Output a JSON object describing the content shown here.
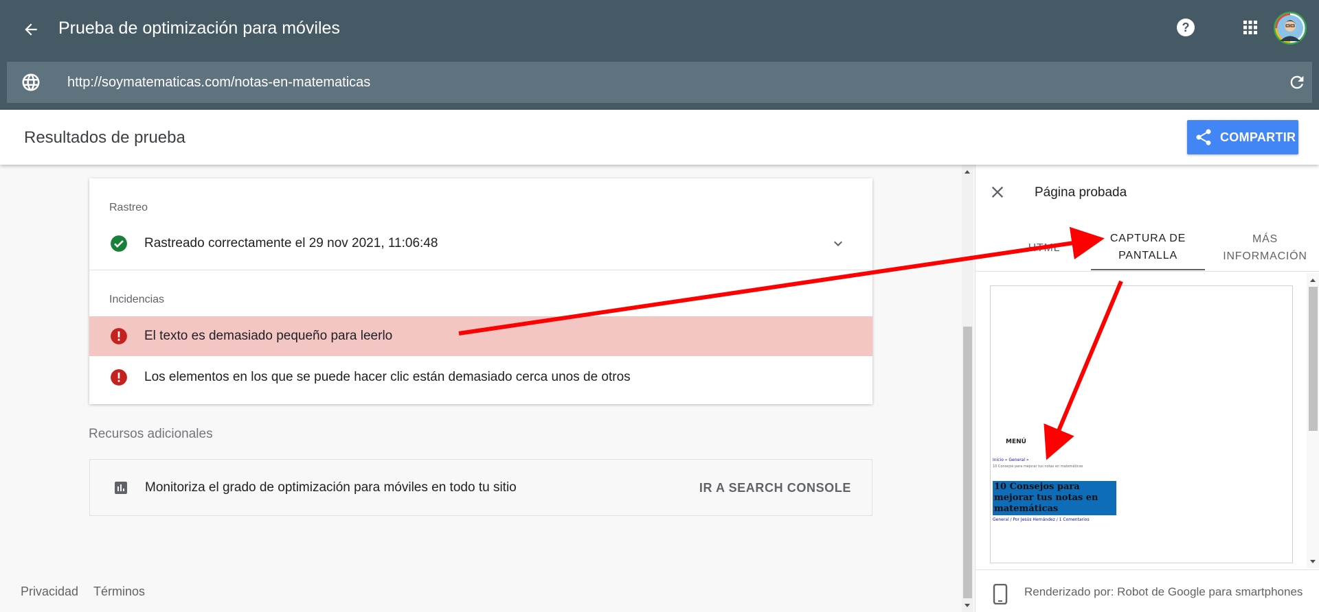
{
  "header": {
    "title": "Prueba de optimización para móviles",
    "url": "http://soymatematicas.com/notas-en-matematicas"
  },
  "results": {
    "title": "Resultados de prueba",
    "share_label": "COMPARTIR"
  },
  "crawl": {
    "section_label": "Rastreo",
    "status_text": "Rastreado correctamente el 29 nov 2021, 11:06:48"
  },
  "issues": {
    "section_label": "Incidencias",
    "items": [
      "El texto es demasiado pequeño para leerlo",
      "Los elementos en los que se puede hacer clic están demasiado cerca unos de otros"
    ]
  },
  "resources": {
    "label": "Recursos adicionales",
    "text": "Monitoriza el grado de optimización para móviles en todo tu sitio",
    "link": "IR A SEARCH CONSOLE"
  },
  "footer": {
    "privacy": "Privacidad",
    "terms": "Términos"
  },
  "panel": {
    "title": "Página probada",
    "tabs": [
      {
        "line1": "HTML",
        "line2": ""
      },
      {
        "line1": "CAPTURA DE",
        "line2": "PANTALLA"
      },
      {
        "line1": "MÁS",
        "line2": "INFORMACIÓN"
      }
    ],
    "screenshot": {
      "menu": "MENÚ",
      "crumbs": "Inicio » General »",
      "crumb2": "10 Consejos para mejorar tus notas en matemáticas",
      "headline": "10 Consejos para mejorar tus notas en matemáticas",
      "meta": "General / Por Jesús Hernández / 1 Comentarios"
    },
    "rendered_by": "Renderizado por: Robot de Google para smartphones"
  },
  "colors": {
    "topbar": "#455a64",
    "urlbar": "#5f737e",
    "share": "#4285f4",
    "highlight": "#f4c6c3",
    "success": "#188038",
    "error": "#c5221f",
    "annotation": "#ff0000"
  },
  "icons": [
    "back-arrow-icon",
    "help-icon",
    "apps-grid-icon",
    "globe-icon",
    "refresh-icon",
    "share-icon",
    "check-circle-icon",
    "error-icon",
    "chevron-down-icon",
    "bar-chart-icon",
    "close-icon",
    "smartphone-icon"
  ]
}
